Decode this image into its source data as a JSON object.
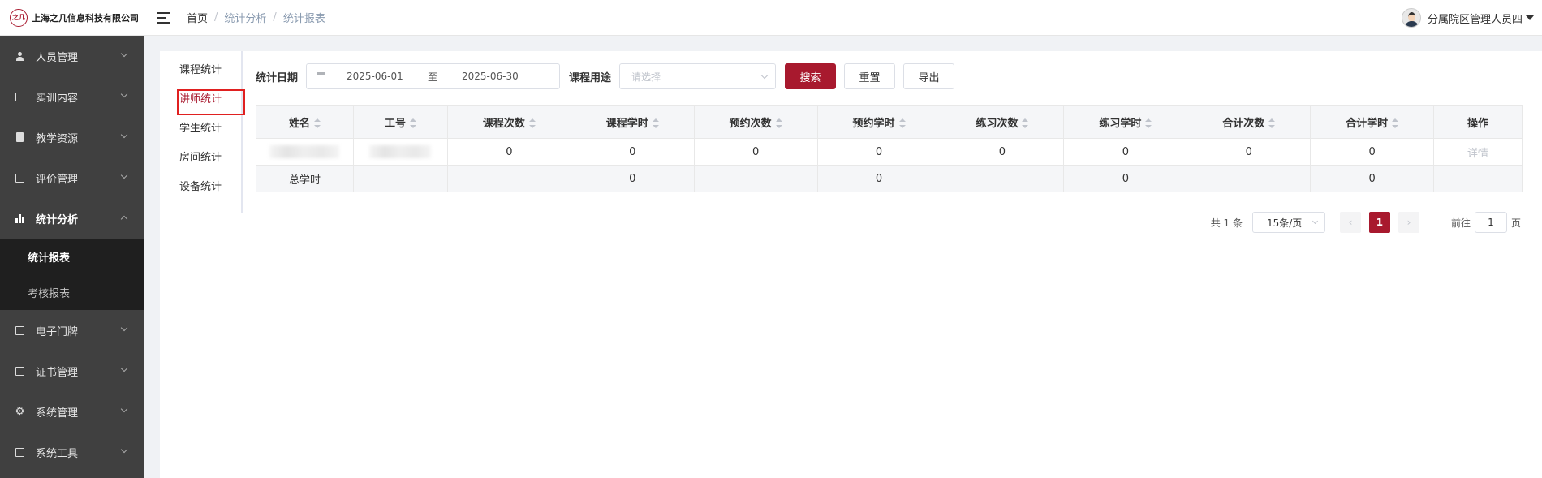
{
  "header": {
    "logo_mark": "之几",
    "company": "上海之几信息科技有限公司",
    "breadcrumb": [
      "首页",
      "统计分析",
      "统计报表"
    ],
    "user_name": "分属院区管理人员四"
  },
  "sidebar": {
    "items": [
      {
        "label": "人员管理",
        "icon": "person-icon"
      },
      {
        "label": "实训内容",
        "icon": "list-icon"
      },
      {
        "label": "教学资源",
        "icon": "book-icon"
      },
      {
        "label": "评价管理",
        "icon": "image-icon"
      },
      {
        "label": "统计分析",
        "icon": "bar-chart-icon"
      },
      {
        "label": "电子门牌",
        "icon": "monitor-icon"
      },
      {
        "label": "证书管理",
        "icon": "briefcase-icon"
      },
      {
        "label": "系统管理",
        "icon": "gear-icon"
      },
      {
        "label": "系统工具",
        "icon": "toolbox-icon"
      }
    ],
    "submenu": [
      "统计报表",
      "考核报表"
    ]
  },
  "tabs": [
    "课程统计",
    "讲师统计",
    "学生统计",
    "房间统计",
    "设备统计"
  ],
  "filters": {
    "date_label": "统计日期",
    "date_start": "2025-06-01",
    "date_sep": "至",
    "date_end": "2025-06-30",
    "purpose_label": "课程用途",
    "purpose_placeholder": "请选择",
    "search_label": "搜索",
    "reset_label": "重置",
    "export_label": "导出"
  },
  "table": {
    "columns": [
      "姓名",
      "工号",
      "课程次数",
      "课程学时",
      "预约次数",
      "预约学时",
      "练习次数",
      "练习学时",
      "合计次数",
      "合计学时",
      "操作"
    ],
    "row": [
      "",
      "",
      "0",
      "0",
      "0",
      "0",
      "0",
      "0",
      "0",
      "0",
      "详情"
    ],
    "total_row": [
      "总学时",
      "",
      "",
      "0",
      "",
      "0",
      "",
      "0",
      "",
      "0",
      ""
    ]
  },
  "pager": {
    "total": "共 1 条",
    "page_size": "15条/页",
    "current_page": "1",
    "goto_prefix": "前往",
    "goto_value": "1",
    "goto_suffix": "页"
  },
  "colors": {
    "accent": "#a8192e",
    "sidebar_bg": "#404040",
    "submenu_bg": "#1f1f1f"
  }
}
